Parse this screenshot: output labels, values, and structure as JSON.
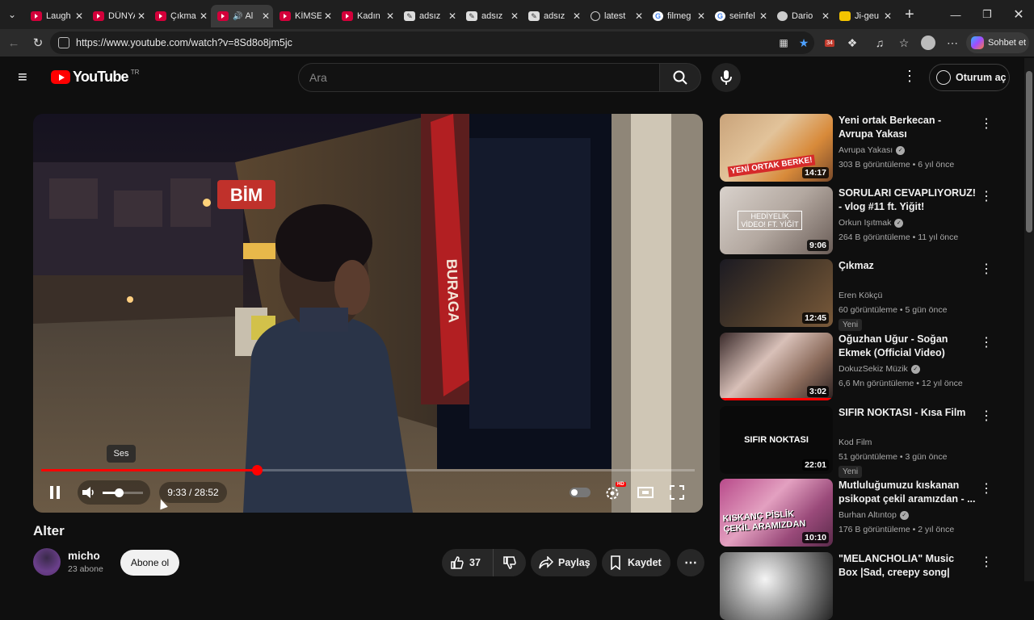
{
  "browser": {
    "tabs": [
      {
        "label": "Laugh",
        "icon": "youtube-icon",
        "active": false
      },
      {
        "label": "DÜNYA",
        "icon": "youtube-icon",
        "active": false
      },
      {
        "label": "Çıkma",
        "icon": "youtube-icon",
        "active": false
      },
      {
        "label": "Al",
        "icon": "youtube-icon",
        "active": true
      },
      {
        "label": "KİMSE",
        "icon": "youtube-icon",
        "active": false
      },
      {
        "label": "Kadın",
        "icon": "youtube-icon",
        "active": false
      },
      {
        "label": "adsız",
        "icon": "document-icon",
        "active": false
      },
      {
        "label": "adsız",
        "icon": "document-icon",
        "active": false
      },
      {
        "label": "adsız",
        "icon": "document-icon",
        "active": false
      },
      {
        "label": "latest",
        "icon": "globe-icon",
        "active": false
      },
      {
        "label": "filmeg",
        "icon": "google-icon",
        "active": false
      },
      {
        "label": "seinfel",
        "icon": "google-icon",
        "active": false
      },
      {
        "label": "Dario",
        "icon": "page-icon",
        "active": false
      },
      {
        "label": "Ji-geu",
        "icon": "ji-icon",
        "active": false
      }
    ],
    "url": "https://www.youtube.com/watch?v=8Sd8o8jm5jc",
    "copilot_label": "Sohbet et",
    "calendar_badge": "34"
  },
  "header": {
    "logo_text": "YouTube",
    "region": "TR",
    "search_placeholder": "Ara",
    "signin_label": "Oturum aç"
  },
  "player": {
    "tooltip": "Ses",
    "time": "9:33 / 28:52",
    "progress": 0.33,
    "volume": 0.4,
    "scene_sign_bim": "BİM",
    "scene_sign_buraga": "BURAGA",
    "hd_badge": "HD",
    "accent": "#ff0000"
  },
  "video": {
    "title": "Alter",
    "channel": "micho",
    "subscribers": "23 abone",
    "subscribe_label": "Abone ol",
    "likes": "37",
    "share_label": "Paylaş",
    "save_label": "Kaydet"
  },
  "recommendations": [
    {
      "title": "Yeni ortak Berkecan - Avrupa Yakası",
      "channel": "Avrupa Yakası",
      "verified": true,
      "meta": "303 B görüntüleme • 6 yıl önce",
      "duration": "14:17",
      "badge": "",
      "thumb_text": "YENİ ORTAK BERKE!",
      "progress": 0
    },
    {
      "title": "SORULARI CEVAPLIYORUZ! - vlog #11 ft. Yiğit!",
      "channel": "Orkun Işıtmak",
      "verified": true,
      "meta": "264 B görüntüleme • 11 yıl önce",
      "duration": "9:06",
      "badge": "",
      "thumb_text": "HEDİYELİK VİDEO! FT. YİĞİT",
      "progress": 0
    },
    {
      "title": "Çıkmaz",
      "channel": "Eren Kökçü",
      "verified": false,
      "meta": "60 görüntüleme • 5 gün önce",
      "duration": "12:45",
      "badge": "Yeni",
      "thumb_text": "",
      "progress": 0
    },
    {
      "title": "Oğuzhan Uğur - Soğan Ekmek (Official Video)",
      "channel": "DokuzSekiz Müzik",
      "verified": true,
      "meta": "6,6 Mn görüntüleme • 12 yıl önce",
      "duration": "3:02",
      "badge": "",
      "thumb_text": "",
      "progress": 1.0
    },
    {
      "title": "SIFIR NOKTASI - Kısa Film",
      "channel": "Kod Film",
      "verified": false,
      "meta": "51 görüntüleme • 3 gün önce",
      "duration": "22:01",
      "badge": "Yeni",
      "thumb_text": "SIFIR NOKTASI",
      "progress": 0
    },
    {
      "title": "Mutluluğumuzu kıskanan psikopat çekil aramızdan - ...",
      "channel": "Burhan Altıntop",
      "verified": true,
      "meta": "176 B görüntüleme • 2 yıl önce",
      "duration": "10:10",
      "badge": "",
      "thumb_text": "KISKANÇ PİSLİK ÇEKİL ARAMIZDAN",
      "progress": 0
    },
    {
      "title": "\"MELANCHOLIA\" Music Box |Sad, creepy song|",
      "channel": "",
      "verified": false,
      "meta": "",
      "duration": "",
      "badge": "",
      "thumb_text": "",
      "progress": 0
    }
  ]
}
